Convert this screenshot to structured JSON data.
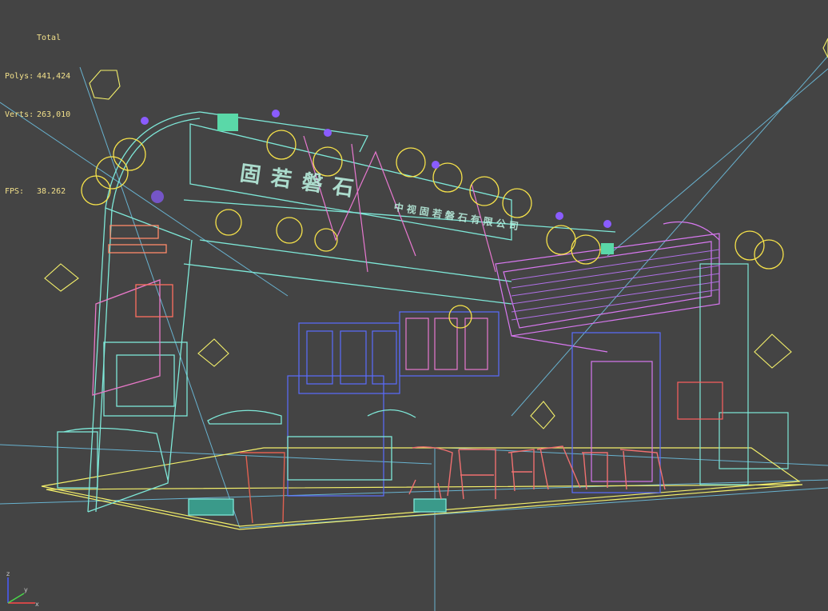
{
  "viewport_stats": {
    "title": "Total",
    "polys_label": "Polys:",
    "polys_value": "441,424",
    "verts_label": "Verts:",
    "verts_value": "263,010",
    "fps_label": "FPS:",
    "fps_value": "38.262"
  },
  "axis_gizmo": {
    "z": "z",
    "y": "y",
    "x": "x"
  },
  "colors": {
    "background": "#444444",
    "stats_text": "#f2e08a",
    "grid_lines": "#6fc6e8",
    "lanterns": "#f6e24a",
    "structure_cyan": "#6fe8c8",
    "structure_magenta": "#e878e8",
    "chairs": "#f07070",
    "columns": "#5a6cff"
  },
  "scene_text": {
    "sign_main": "固 若 磐 石",
    "sign_brand": "中 视 固 若 磐 石 有 限 公 司"
  }
}
